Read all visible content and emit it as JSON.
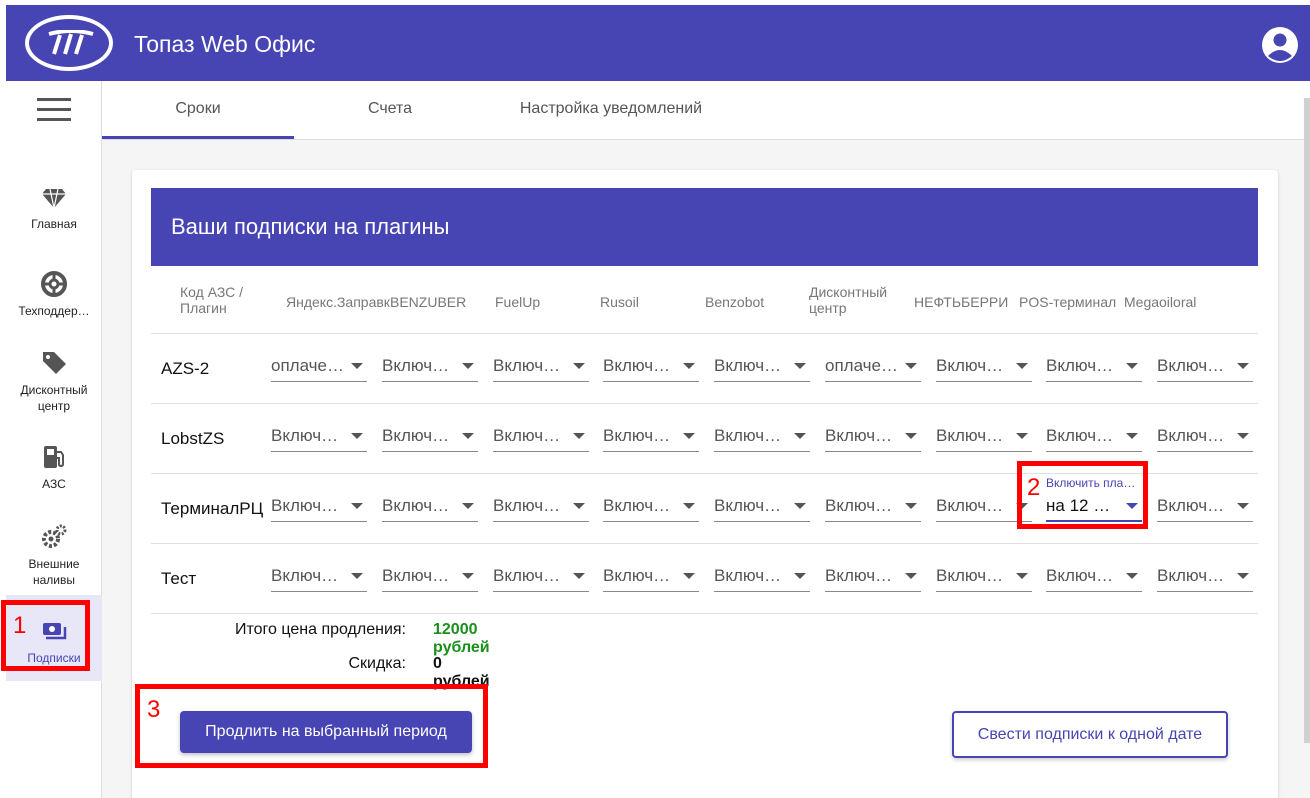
{
  "app": {
    "title": "Топаз Web Офис"
  },
  "header": {
    "logo_icon": "topaz-logo",
    "account_icon": "account-circle-icon"
  },
  "sidebar": {
    "menu_icon": "hamburger-menu-icon",
    "items": [
      {
        "label": "Главная",
        "icon": "diamond-icon"
      },
      {
        "label": "Техподдер…",
        "icon": "lifebuoy-icon"
      },
      {
        "label": "Дисконтный центр",
        "icon": "tag-icon"
      },
      {
        "label": "АЗС",
        "icon": "fuel-pump-icon"
      },
      {
        "label": "Внешние наливы",
        "icon": "gears-icon"
      },
      {
        "label": "Подписки",
        "icon": "cash-icon",
        "active": true
      }
    ]
  },
  "tabs": [
    {
      "label": "Сроки",
      "active": true
    },
    {
      "label": "Счета"
    },
    {
      "label": "Настройка уведомлений"
    }
  ],
  "card": {
    "title": "Ваши подписки на плагины",
    "first_column": "Код АЗС / Плагин",
    "columns": [
      "Яндекс.Заправк",
      "BENZUBER",
      "FuelUp",
      "Rusoil",
      "Benzobot",
      "Дисконтный центр",
      "НЕФТЬБЕРРИ",
      "POS-терминал",
      "Megaoiloral"
    ],
    "rows": [
      {
        "station": "AZS-2",
        "values": [
          "оплаче…",
          "Включ…",
          "Включ…",
          "Включ…",
          "Включ…",
          "оплаче…",
          "Включ…",
          "Включ…",
          "Включ…"
        ]
      },
      {
        "station": "LobstZS",
        "values": [
          "Включ…",
          "Включ…",
          "Включ…",
          "Включ…",
          "Включ…",
          "Включ…",
          "Включ…",
          "Включ…",
          "Включ…"
        ]
      },
      {
        "station": "ТерминалРЦ",
        "values": [
          "Включ…",
          "Включ…",
          "Включ…",
          "Включ…",
          "Включ…",
          "Включ…",
          "Включ…",
          "на 12 …",
          "Включ…"
        ]
      },
      {
        "station": "Тест",
        "values": [
          "Включ…",
          "Включ…",
          "Включ…",
          "Включ…",
          "Включ…",
          "Включ…",
          "Включ…",
          "Включ…",
          "Включ…"
        ]
      }
    ],
    "focused_select_label": "Включить пла…",
    "summary": {
      "total_label": "Итого цена продления:",
      "total_value": "12000 рублей",
      "discount_label": "Скидка:",
      "discount_value": "0 рублей"
    },
    "buttons": {
      "extend": "Продлить на выбранный период",
      "align": "Свести подписки к одной дате"
    }
  },
  "annotations": [
    "1",
    "2",
    "3"
  ],
  "colors": {
    "primary": "#4744b3",
    "total_value": "#1a8f1a",
    "annotation": "#ff0000"
  }
}
